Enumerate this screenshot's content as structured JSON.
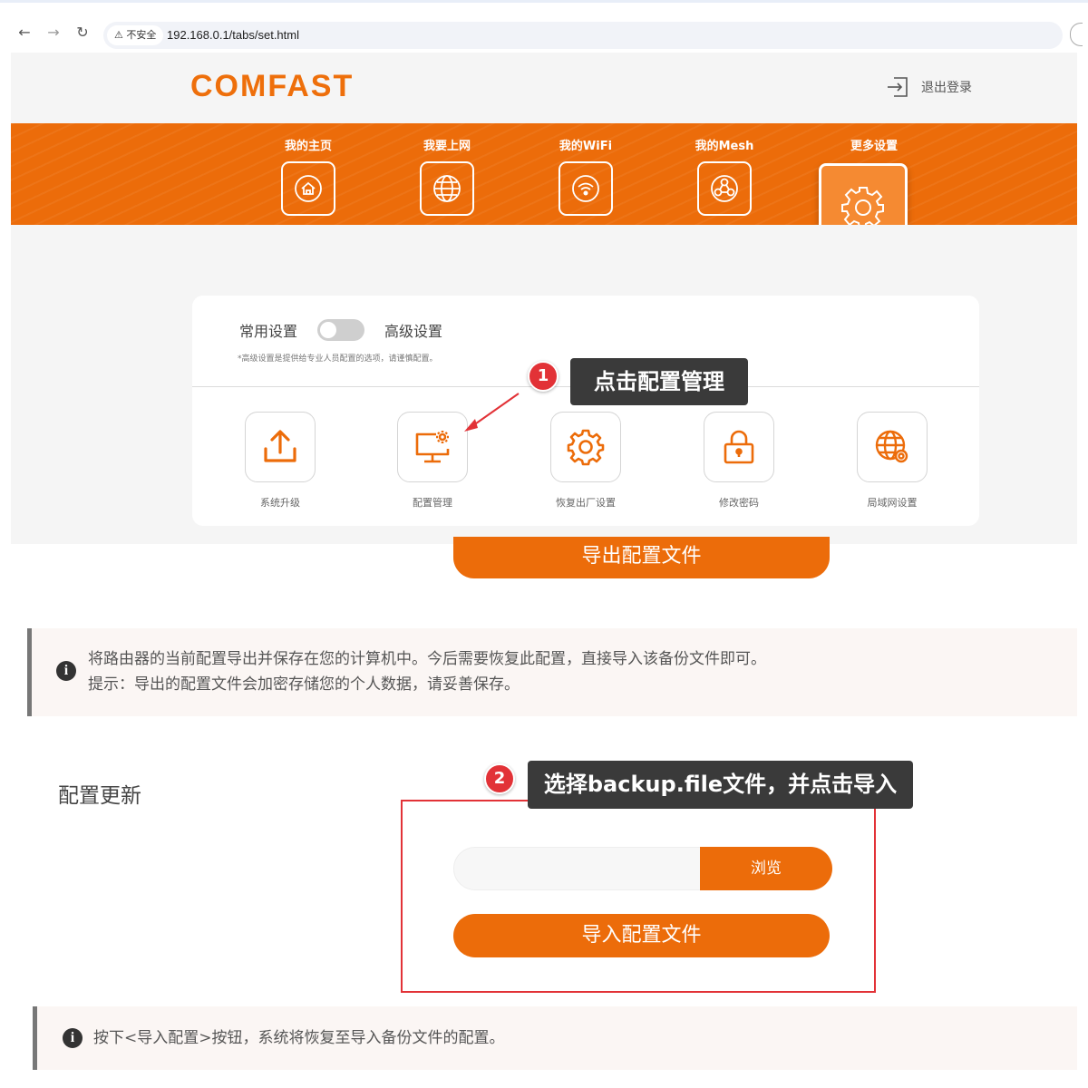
{
  "browser": {
    "security_label": "⚠ 不安全",
    "url": "192.168.0.1/tabs/set.html"
  },
  "header": {
    "logo_text": "COMFAST",
    "logout_label": "退出登录"
  },
  "nav": {
    "items": [
      {
        "label": "我的主页",
        "icon": "home-icon"
      },
      {
        "label": "我要上网",
        "icon": "globe-icon"
      },
      {
        "label": "我的WiFi",
        "icon": "wifi-icon"
      },
      {
        "label": "我的Mesh",
        "icon": "mesh-icon"
      },
      {
        "label": "更多设置",
        "icon": "gear-icon",
        "active": true
      }
    ]
  },
  "settings": {
    "common_label": "常用设置",
    "advanced_label": "高级设置",
    "toggle_state": "off",
    "note": "*高级设置是提供给专业人员配置的选项，请谨慎配置。",
    "tools": [
      {
        "label": "系统升级",
        "icon": "upload-icon"
      },
      {
        "label": "配置管理",
        "icon": "config-monitor-icon"
      },
      {
        "label": "恢复出厂设置",
        "icon": "gear-icon"
      },
      {
        "label": "修改密码",
        "icon": "lock-icon"
      },
      {
        "label": "局域网设置",
        "icon": "lan-globe-icon"
      }
    ]
  },
  "annotations": {
    "step1_number": "1",
    "step1_text": "点击配置管理",
    "step2_number": "2",
    "step2_text": "选择backup.file文件，并点击导入"
  },
  "export": {
    "button_label": "导出配置文件",
    "info_line1": "将路由器的当前配置导出并保存在您的计算机中。今后需要恢复此配置，直接导入该备份文件即可。",
    "info_line2": "提示：导出的配置文件会加密存储您的个人数据，请妥善保存。"
  },
  "update": {
    "title": "配置更新",
    "browse_label": "浏览",
    "import_label": "导入配置文件",
    "info_text": "按下<导入配置>按钮，系统将恢复至导入备份文件的配置。"
  },
  "colors": {
    "accent": "#ec6c0a",
    "annotation_red": "#e23237",
    "callout_bg": "#3a3a3a"
  }
}
